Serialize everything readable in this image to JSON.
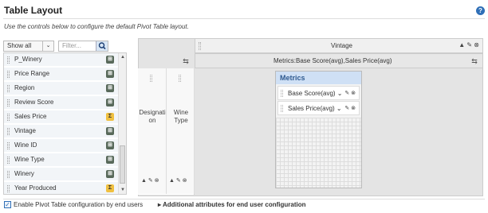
{
  "header": {
    "title": "Table Layout",
    "help": "?"
  },
  "description": "Use the controls below to configure the default Pivot Table layout.",
  "filter_bar": {
    "show_label": "Show all",
    "dropdown_glyph": "⌄",
    "filter_placeholder": "Filter..."
  },
  "field_list": [
    {
      "label": "P_Winery",
      "icon": "dimension-icon",
      "glyph": "⊞"
    },
    {
      "label": "Price Range",
      "icon": "dimension-icon",
      "glyph": "⊞"
    },
    {
      "label": "Region",
      "icon": "dimension-icon",
      "glyph": "⊞"
    },
    {
      "label": "Review Score",
      "icon": "dimension-icon",
      "glyph": "⊞"
    },
    {
      "label": "Sales Price",
      "icon": "metric-icon",
      "glyph": "Σ"
    },
    {
      "label": "Vintage",
      "icon": "dimension-icon",
      "glyph": "⊞"
    },
    {
      "label": "Wine ID",
      "icon": "dimension-icon",
      "glyph": "⊞"
    },
    {
      "label": "Wine Type",
      "icon": "dimension-icon",
      "glyph": "⊞"
    },
    {
      "label": "Winery",
      "icon": "dimension-icon",
      "glyph": "⊞"
    },
    {
      "label": "Year Produced",
      "icon": "metric-icon",
      "glyph": "Σ"
    }
  ],
  "columns_area": {
    "vintage_label": "Vintage",
    "metrics_label": "Metrics:Base Score(avg),Sales Price(avg)"
  },
  "rows_area": {
    "designation_label": "Designati on",
    "wine_type_label": "Wine Type",
    "row_tools": "▲ ✎ ⊗"
  },
  "metrics_box": {
    "title": "Metrics",
    "items": [
      {
        "label": "Base Score(avg) ⌄",
        "tools": "✎ ⊗"
      },
      {
        "label": "Sales Price(avg) ⌄",
        "tools": "✎ ⊗"
      }
    ]
  },
  "footer": {
    "checkbox_checked": true,
    "checkbox_label": "Enable Pivot Table configuration by end users",
    "additional_label": "▸ Additional attributes for end user configuration"
  },
  "colors": {
    "accent": "#2f6fb7",
    "metric_head_bg": "#cfe0f5",
    "dim_icon": "#58695a",
    "metric_icon": "#f0c040"
  }
}
